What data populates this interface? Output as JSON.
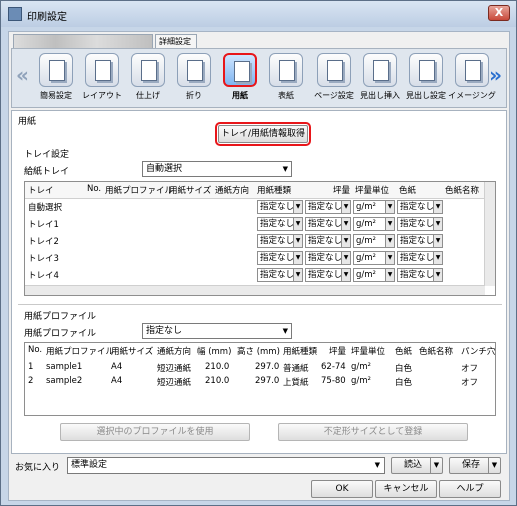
{
  "window": {
    "title": "印刷設定",
    "close": "X"
  },
  "tabs": {
    "detail": "詳細設定"
  },
  "ribbon": {
    "items": [
      "簡易設定",
      "レイアウト",
      "仕上げ",
      "折り",
      "用紙",
      "表紙",
      "ページ設定",
      "見出し挿入",
      "見出し設定",
      "イメージング"
    ],
    "selected": "用紙",
    "arrow_left": "«",
    "arrow_right": "»"
  },
  "paper": {
    "section": "用紙",
    "get_button": "トレイ/用紙情報取得",
    "tray_section": "トレイ設定",
    "feed_tray_label": "給紙トレイ",
    "feed_tray_value": "自動選択"
  },
  "tray_table": {
    "headers": [
      "トレイ",
      "No.",
      "用紙プロファイル",
      "用紙サイズ",
      "通紙方向",
      "用紙種類",
      "坪量",
      "坪量単位",
      "色紙",
      "色紙名称"
    ],
    "rows": [
      {
        "tray": "自動選択",
        "type": "指定なし",
        "weight": "指定なし",
        "unit": "g/m²",
        "color": "指定なし"
      },
      {
        "tray": "トレイ1",
        "type": "指定なし",
        "weight": "指定なし",
        "unit": "g/m²",
        "color": "指定なし"
      },
      {
        "tray": "トレイ2",
        "type": "指定なし",
        "weight": "指定なし",
        "unit": "g/m²",
        "color": "指定なし"
      },
      {
        "tray": "トレイ3",
        "type": "指定なし",
        "weight": "指定なし",
        "unit": "g/m²",
        "color": "指定なし"
      },
      {
        "tray": "トレイ4",
        "type": "指定なし",
        "weight": "指定なし",
        "unit": "g/m²",
        "color": "指定なし"
      }
    ]
  },
  "profile": {
    "section": "用紙プロファイル",
    "label": "用紙プロファイル",
    "value": "指定なし",
    "headers": [
      "No.",
      "用紙プロファイル",
      "用紙サイズ",
      "通紙方向",
      "幅 (mm)",
      "高さ (mm)",
      "用紙種類",
      "坪量",
      "坪量単位",
      "色紙",
      "色紙名称",
      "パンチ穴"
    ],
    "rows": [
      [
        "1",
        "sample1",
        "A4",
        "短辺通紙",
        "210.0",
        "297.0",
        "普通紙",
        "62-74",
        "g/m²",
        "白色",
        "",
        "オフ"
      ],
      [
        "2",
        "sample2",
        "A4",
        "短辺通紙",
        "210.0",
        "297.0",
        "上質紙",
        "75-80",
        "g/m²",
        "白色",
        "",
        "オフ"
      ]
    ],
    "use_button": "選択中のプロファイルを使用",
    "register_button": "不定形サイズとして登録"
  },
  "favorites": {
    "label": "お気に入り",
    "value": "標準設定",
    "load": "読込",
    "save": "保存"
  },
  "dialog": {
    "ok": "OK",
    "cancel": "キャンセル",
    "help": "ヘルプ"
  },
  "colors": {
    "highlight": "#e8161a"
  }
}
